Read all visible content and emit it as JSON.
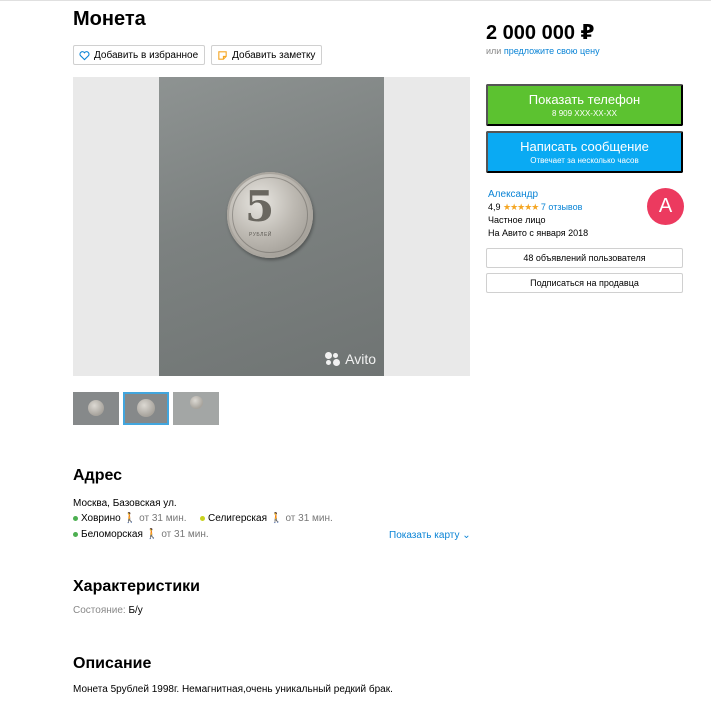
{
  "listing": {
    "title": "Монета",
    "favorite_label": "Добавить в избранное",
    "note_label": "Добавить заметку",
    "watermark": "Avito",
    "coin": {
      "value": "5",
      "caption": "РУБЛЕЙ"
    }
  },
  "pricing": {
    "price": "2 000 000 ₽",
    "offer_prefix": "или",
    "offer_link": "предложите свою цену"
  },
  "contact": {
    "phone_button": "Показать телефон",
    "phone_masked": "8 909 XXX-XX-XX",
    "message_button": "Написать сообщение",
    "message_sub": "Отвечает за несколько часов"
  },
  "seller": {
    "name": "Александр",
    "rating": "4,9",
    "stars": "★★★★★",
    "reviews": "7 отзывов",
    "type": "Частное лицо",
    "since": "На Авито с января 2018",
    "avatar_letter": "А",
    "ads_button": "48 объявлений пользователя",
    "subscribe_button": "Подписаться на продавца"
  },
  "address": {
    "heading": "Адрес",
    "line": "Москва, Базовская ул.",
    "metros": [
      {
        "name": "Ховрино",
        "time": "от 31 мин.",
        "color": "#4caf50"
      },
      {
        "name": "Селигерская",
        "time": "от 31 мин.",
        "color": "#c8d21e"
      },
      {
        "name": "Беломорская",
        "time": "от 31 мин.",
        "color": "#4caf50"
      }
    ],
    "map_link": "Показать карту"
  },
  "characteristics": {
    "heading": "Характеристики",
    "condition_label": "Состояние:",
    "condition_value": "Б/у"
  },
  "description": {
    "heading": "Описание",
    "text": "Монета 5рублей 1998г. Немагнитная,очень уникальный редкий брак."
  },
  "colors": {
    "green_button": "#5cc230",
    "blue_button": "#0aaaf3",
    "link": "#0a84d6",
    "avatar": "#ec3a5f"
  }
}
